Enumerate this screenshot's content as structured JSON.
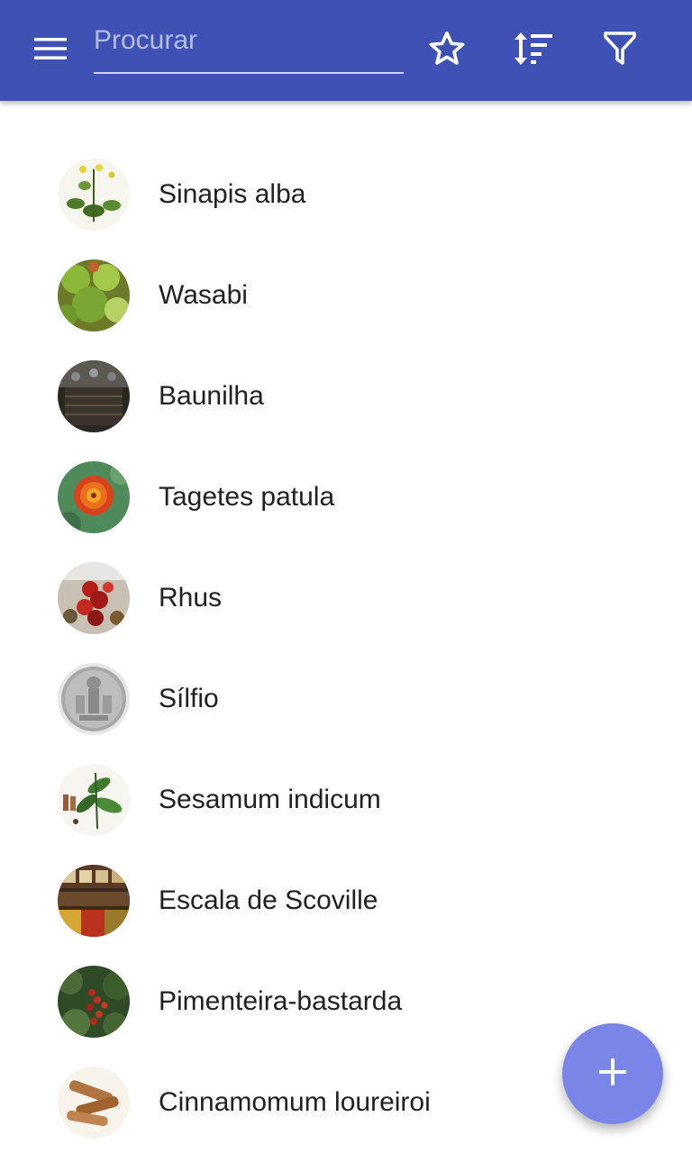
{
  "toolbar": {
    "search_placeholder": "Procurar",
    "search_value": "",
    "icons": [
      "menu-icon",
      "star-outline-icon",
      "sort-icon",
      "filter-icon"
    ],
    "color": "#3f51b5"
  },
  "plants": [
    {
      "name": "Sinapis alba"
    },
    {
      "name": "Wasabi"
    },
    {
      "name": "Baunilha"
    },
    {
      "name": "Tagetes patula"
    },
    {
      "name": "Rhus"
    },
    {
      "name": "Sílfio"
    },
    {
      "name": "Sesamum indicum"
    },
    {
      "name": "Escala de Scoville"
    },
    {
      "name": "Pimenteira-bastarda"
    },
    {
      "name": "Cinnamomum loureiroi"
    }
  ],
  "fab": {
    "icon": "plus-icon",
    "color": "#7986e8"
  }
}
